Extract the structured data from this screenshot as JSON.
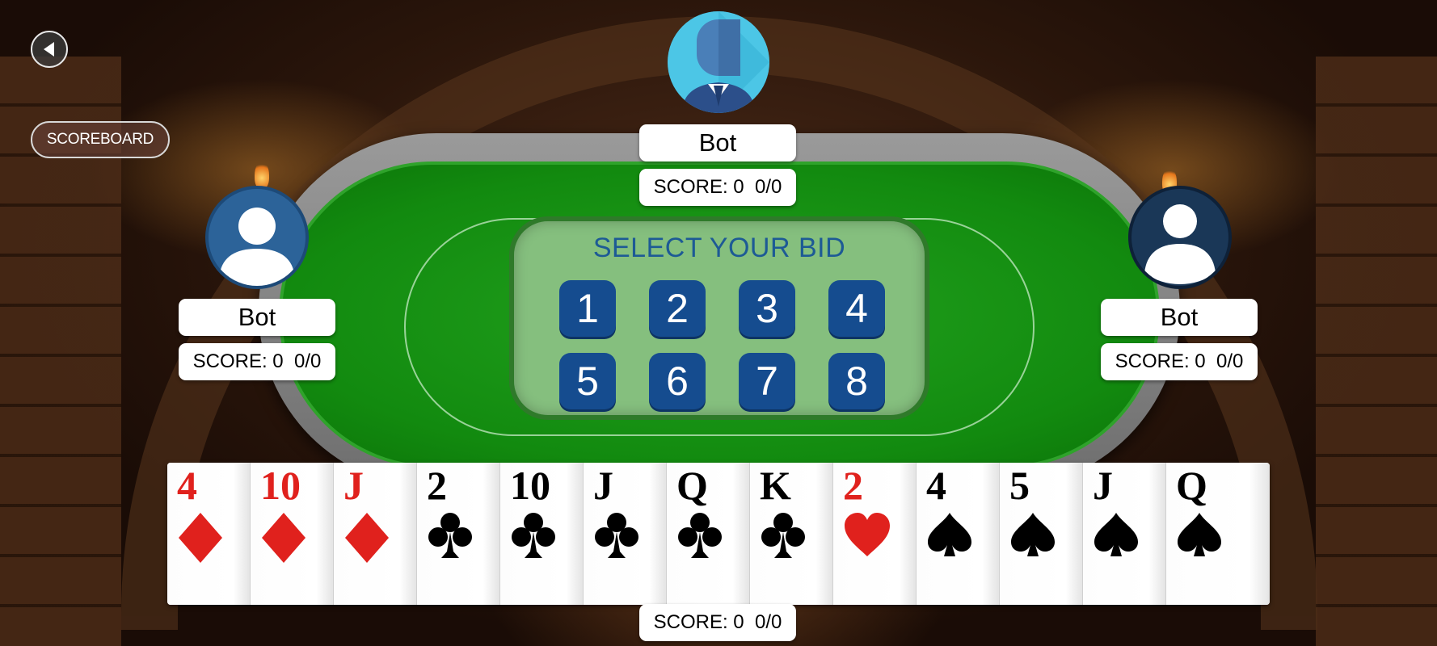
{
  "nav": {
    "back_icon": "back-arrow-icon",
    "scoreboard_label": "SCOREBOARD"
  },
  "players": {
    "top": {
      "name": "Bot",
      "score": "SCORE: 0  0/0",
      "avatar": "male-avatar-icon"
    },
    "left": {
      "name": "Bot",
      "score": "SCORE: 0  0/0",
      "avatar": "user-avatar-icon"
    },
    "right": {
      "name": "Bot",
      "score": "SCORE: 0  0/0",
      "avatar": "user-avatar-icon"
    },
    "self": {
      "score": "SCORE: 0  0/0"
    }
  },
  "bid": {
    "title": "SELECT YOUR BID",
    "options": [
      "1",
      "2",
      "3",
      "4",
      "5",
      "6",
      "7",
      "8"
    ]
  },
  "colors": {
    "felt": "#128a0f",
    "bid_button": "#154c8f",
    "bid_title": "#1d5a95",
    "red_suit": "#e0211d",
    "black_suit": "#000000"
  },
  "hand": [
    {
      "rank": "4",
      "suit": "diamond"
    },
    {
      "rank": "10",
      "suit": "diamond"
    },
    {
      "rank": "J",
      "suit": "diamond"
    },
    {
      "rank": "2",
      "suit": "club"
    },
    {
      "rank": "10",
      "suit": "club"
    },
    {
      "rank": "J",
      "suit": "club"
    },
    {
      "rank": "Q",
      "suit": "club"
    },
    {
      "rank": "K",
      "suit": "club"
    },
    {
      "rank": "2",
      "suit": "heart"
    },
    {
      "rank": "4",
      "suit": "spade"
    },
    {
      "rank": "5",
      "suit": "spade"
    },
    {
      "rank": "J",
      "suit": "spade"
    },
    {
      "rank": "Q",
      "suit": "spade"
    }
  ]
}
